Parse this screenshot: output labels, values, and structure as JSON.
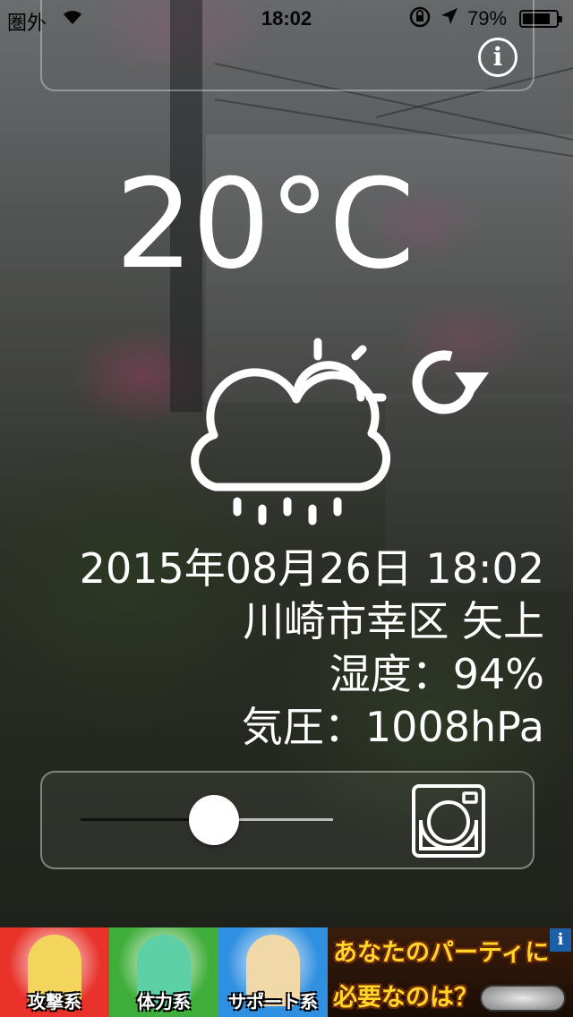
{
  "status_bar": {
    "carrier": "圏外",
    "time": "18:02",
    "battery_text": "79%",
    "battery_level": 0.79
  },
  "weather": {
    "temperature": "20°C",
    "condition_icon": "partly-cloudy-rain-icon",
    "datetime": "2015年08月26日 18:02",
    "location": "川崎市幸区 矢上",
    "humidity": "湿度：94%",
    "pressure": "気圧：1008hPa"
  },
  "controls": {
    "slider_value": 0.53,
    "camera_icon": "camera-icon",
    "refresh_icon": "refresh-icon",
    "info_label": "i"
  },
  "ad": {
    "tiles": [
      {
        "label": "攻撃系",
        "color": "#e8322a"
      },
      {
        "label": "体力系",
        "color": "#3fae3a"
      },
      {
        "label": "サポート系",
        "color": "#2f8fe0"
      }
    ],
    "copy_line1": "あなたのパーティに",
    "copy_line2": "必要なのは？",
    "info_label": "i"
  },
  "colors": {
    "text": "#ffffff",
    "panel_border": "rgba(255,255,255,0.4)"
  }
}
